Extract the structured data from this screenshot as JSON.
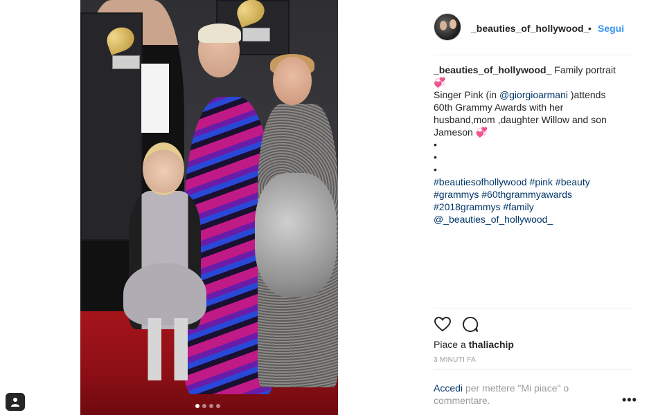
{
  "post": {
    "username": "_beauties_of_hollywood_",
    "separator": "•",
    "follow_label": "Segui",
    "caption": {
      "username": "_beauties_of_hollywood_",
      "line1_text": "Family portrait",
      "heart": "💞",
      "line2_prefix": "Singer Pink (in ",
      "mention_brand": "@giorgioarmani",
      "line2_suffix": " )attends",
      "line3": "60th Grammy Awards with her",
      "line4": "husband,mom ,daughter Willow and son",
      "line5": "Jameson",
      "bullets": [
        "•",
        "•",
        "•"
      ],
      "hashtags_line1": [
        "#beautiesofhollywood",
        "#pink",
        "#beauty"
      ],
      "hashtags_line2": [
        "#grammys",
        "#60thgrammyawards"
      ],
      "hashtags_line3": [
        "#2018grammys",
        "#family"
      ],
      "mention_account": "@_beauties_of_hollywood_"
    },
    "likes_prefix": "Piace a ",
    "likes_user": "thaliachip",
    "time_ago": "3 MINUTI FA",
    "login_link": "Accedi",
    "login_rest": " per mettere \"Mi piace\" o commentare.",
    "more_label": "•••",
    "carousel_dots": 4,
    "carousel_active": 1
  },
  "colors": {
    "link_blue": "#3897f0",
    "hashtag_blue": "#003569",
    "text": "#262626",
    "muted": "#999999",
    "heart_pink": "#f27ac4"
  },
  "icons": {
    "like": "heart-icon",
    "comment": "comment-icon",
    "corner": "user-tag-icon"
  }
}
